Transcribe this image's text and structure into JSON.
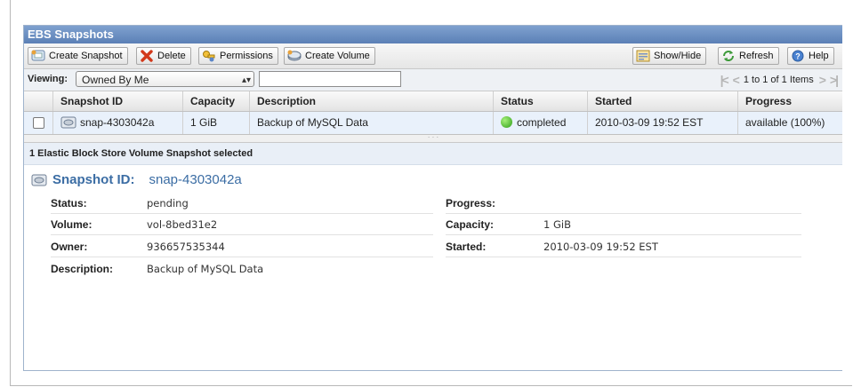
{
  "panel": {
    "title": "EBS Snapshots"
  },
  "toolbar": {
    "create_snapshot": "Create Snapshot",
    "delete": "Delete",
    "permissions": "Permissions",
    "create_volume": "Create Volume",
    "show_hide": "Show/Hide",
    "refresh": "Refresh",
    "help": "Help"
  },
  "filter": {
    "viewing_label": "Viewing:",
    "selected_option": "Owned By Me",
    "search_value": "",
    "pager_text": "1 to 1 of 1 Items"
  },
  "table": {
    "columns": [
      "Snapshot ID",
      "Capacity",
      "Description",
      "Status",
      "Started",
      "Progress"
    ],
    "rows": [
      {
        "snapshot_id": "snap-4303042a",
        "capacity": "1 GiB",
        "description": "Backup of MySQL Data",
        "status": "completed",
        "started": "2010-03-09 19:52 EST",
        "progress": "available (100%)"
      }
    ]
  },
  "details": {
    "selection_text": "1 Elastic Block Store Volume Snapshot selected",
    "snapshot_id_label": "Snapshot ID:",
    "snapshot_id": "snap-4303042a",
    "status_label": "Status:",
    "status": "pending",
    "volume_label": "Volume:",
    "volume": "vol-8bed31e2",
    "owner_label": "Owner:",
    "owner": "936657535344",
    "description_label": "Description:",
    "description": "Backup of MySQL Data",
    "progress_label": "Progress:",
    "progress": "",
    "capacity_label": "Capacity:",
    "capacity": "1 GiB",
    "started_label": "Started:",
    "started": "2010-03-09 19:52 EST"
  },
  "colors": {
    "title_bar": "#5b80b6",
    "accent_text": "#3b6da4",
    "selected_row": "#e9f1fb",
    "status_completed": "#2e9e18"
  }
}
